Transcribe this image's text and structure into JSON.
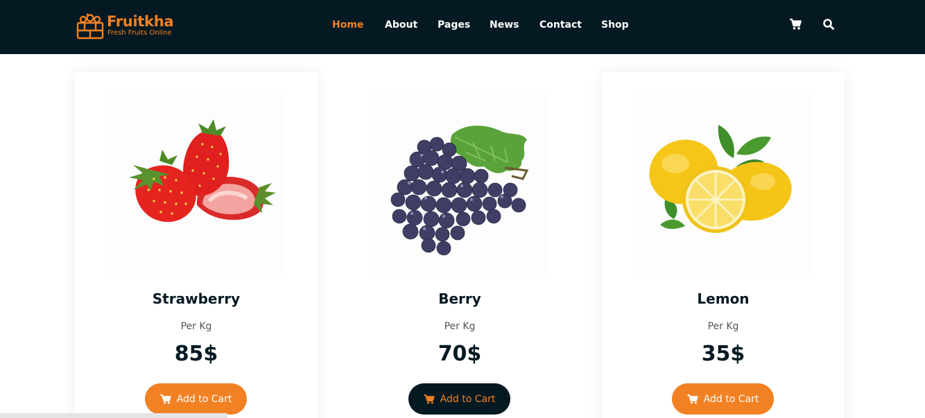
{
  "brand": {
    "name": "Fruitkha",
    "tagline": "Fresh Fruits Online",
    "accent_color": "#F28123",
    "dark_color": "#051922"
  },
  "nav": {
    "items": [
      {
        "label": "Home",
        "active": true
      },
      {
        "label": "About",
        "active": false
      },
      {
        "label": "Pages",
        "active": false
      },
      {
        "label": "News",
        "active": false
      },
      {
        "label": "Contact",
        "active": false
      },
      {
        "label": "Shop",
        "active": false
      }
    ],
    "icons": [
      "shopping-cart-icon",
      "search-icon"
    ]
  },
  "products": [
    {
      "name": "Strawberry",
      "unit": "Per Kg",
      "price": "85$",
      "button_label": "Add to Cart",
      "image_icon": "strawberry-image"
    },
    {
      "name": "Berry",
      "unit": "Per Kg",
      "price": "70$",
      "button_label": "Add to Cart",
      "image_icon": "grapes-image",
      "button_style": "dark"
    },
    {
      "name": "Lemon",
      "unit": "Per Kg",
      "price": "35$",
      "button_label": "Add to Cart",
      "image_icon": "lemon-image"
    }
  ]
}
